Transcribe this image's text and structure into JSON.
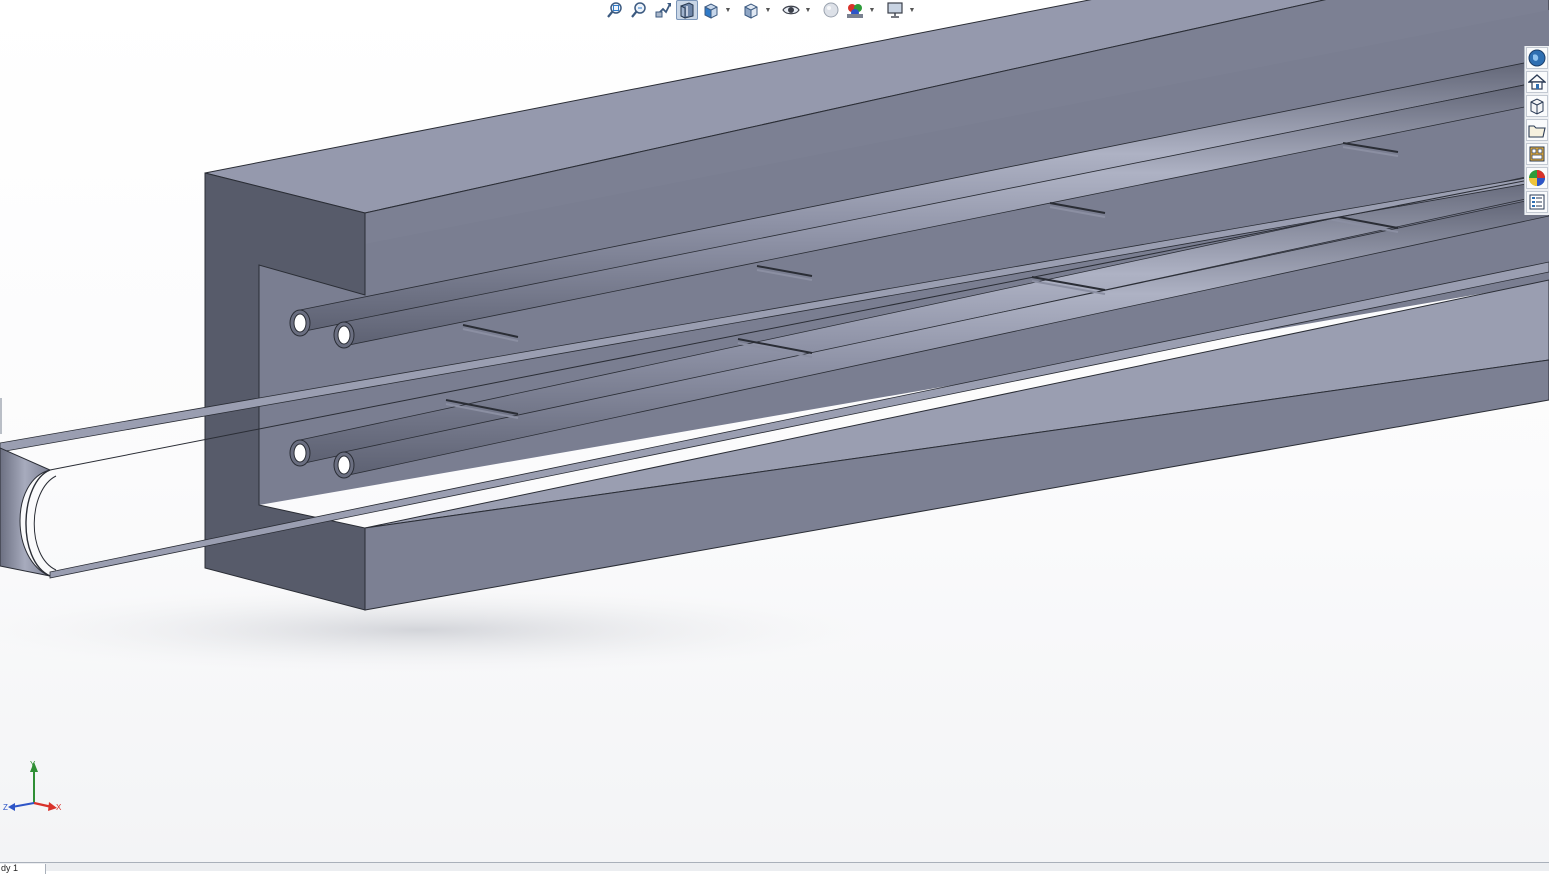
{
  "view_toolbar": {
    "buttons": [
      {
        "name": "zoom-to-fit",
        "icon": "zoom-to-fit-icon"
      },
      {
        "name": "zoom-to-area",
        "icon": "zoom-to-area-icon"
      },
      {
        "name": "previous-view",
        "icon": "previous-view-icon"
      },
      {
        "name": "section-view",
        "icon": "section-view-icon",
        "active": true
      },
      {
        "name": "view-orientation",
        "icon": "view-orientation-icon",
        "dropdown": true
      },
      {
        "name": "display-style",
        "icon": "display-style-icon",
        "dropdown": true
      },
      {
        "name": "hide-show-items",
        "icon": "eye-icon",
        "dropdown": true
      },
      {
        "name": "edit-appearance",
        "icon": "edit-appearance-icon"
      },
      {
        "name": "apply-scene",
        "icon": "apply-scene-icon",
        "dropdown": true
      },
      {
        "name": "view-settings",
        "icon": "monitor-icon",
        "dropdown": true
      }
    ]
  },
  "task_pane": {
    "tabs": [
      {
        "name": "resources",
        "icon": "globe-icon"
      },
      {
        "name": "home",
        "icon": "home-icon"
      },
      {
        "name": "design-library",
        "icon": "design-library-icon"
      },
      {
        "name": "file-explorer",
        "icon": "folder-icon"
      },
      {
        "name": "view-palette",
        "icon": "view-palette-icon"
      },
      {
        "name": "appearances",
        "icon": "appearances-icon"
      },
      {
        "name": "custom-properties",
        "icon": "custom-properties-icon"
      }
    ]
  },
  "triad": {
    "x_label": "X",
    "y_label": "Y",
    "z_label": "Z"
  },
  "colors": {
    "model_top": "#9599ad",
    "model_side": "#7c8093",
    "model_dark": "#565a69",
    "section_face": "#6f7386",
    "axis_x": "#d9322b",
    "axis_y": "#2f8f35",
    "axis_z": "#2e55c7",
    "active_button": "#c9d6e6"
  },
  "bottom_tab": {
    "label": "dy 1"
  }
}
